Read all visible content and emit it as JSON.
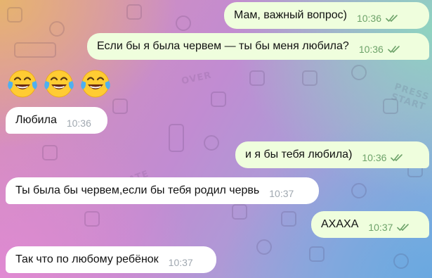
{
  "chat": {
    "messages": [
      {
        "direction": "out",
        "text": "Мам, важный вопрос)",
        "time": "10:36",
        "read": true
      },
      {
        "direction": "out",
        "text": "Если бы я была червем — ты бы меня любила?",
        "time": "10:36",
        "read": true
      },
      {
        "direction": "in",
        "emoji": [
          "face-with-tears-of-joy",
          "face-with-tears-of-joy",
          "face-with-tears-of-joy"
        ]
      },
      {
        "direction": "in",
        "text": "Любила",
        "time": "10:36"
      },
      {
        "direction": "out",
        "text": "и я бы тебя любила)",
        "time": "10:36",
        "read": true
      },
      {
        "direction": "in",
        "text": "Ты была бы червем,если бы тебя родил червь",
        "time": "10:37"
      },
      {
        "direction": "out",
        "text": "АХАХА",
        "time": "10:37",
        "read": true
      },
      {
        "direction": "in",
        "text": "Так что по любому ребёнок",
        "time": "10:37"
      }
    ]
  },
  "background": {
    "doodle_texts": [
      "PRESS START",
      "UPDATE",
      "OVER"
    ]
  },
  "colors": {
    "outgoing_bubble": "#effedd",
    "incoming_bubble": "#ffffff",
    "outgoing_time": "#6ea36a",
    "incoming_time": "#a0a8b0",
    "read_checks": "#6ea36a"
  }
}
